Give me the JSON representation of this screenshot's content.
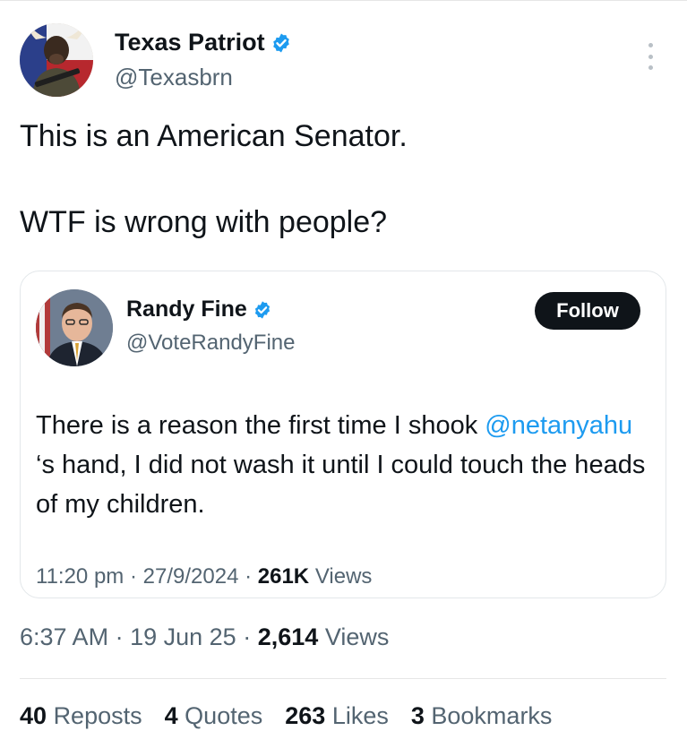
{
  "colors": {
    "text": "#0f1419",
    "secondary": "#536471",
    "link": "#1d9bf0",
    "verified": "#1d9bf0",
    "follow_bg": "#0f1419"
  },
  "author": {
    "name": "Texas Patriot",
    "handle": "@Texasbrn",
    "verified_icon": "verified-badge-icon",
    "avatar_icon": "bull-avatar-icon"
  },
  "tweet": {
    "line1": "This is an American Senator.",
    "line2": "WTF is wrong with people?"
  },
  "quote": {
    "name": "Randy Fine",
    "handle": "@VoteRandyFine",
    "follow_label": "Follow",
    "text_before": "There is a reason the first time I shook ",
    "mention": "@netanyahu",
    "text_after": " ‘s hand, I did not wash it until I could touch the heads of my children.",
    "time": "11:20 pm",
    "date": "27/9/2024",
    "views_count": "261K",
    "views_label": "Views"
  },
  "meta": {
    "time": "6:37 AM",
    "date": "19 Jun 25",
    "views_count": "2,614",
    "views_label": "Views",
    "separator": "·"
  },
  "stats": {
    "reposts_count": "40",
    "reposts_label": "Reposts",
    "quotes_count": "4",
    "quotes_label": "Quotes",
    "likes_count": "263",
    "likes_label": "Likes",
    "bookmarks_count": "3",
    "bookmarks_label": "Bookmarks"
  }
}
